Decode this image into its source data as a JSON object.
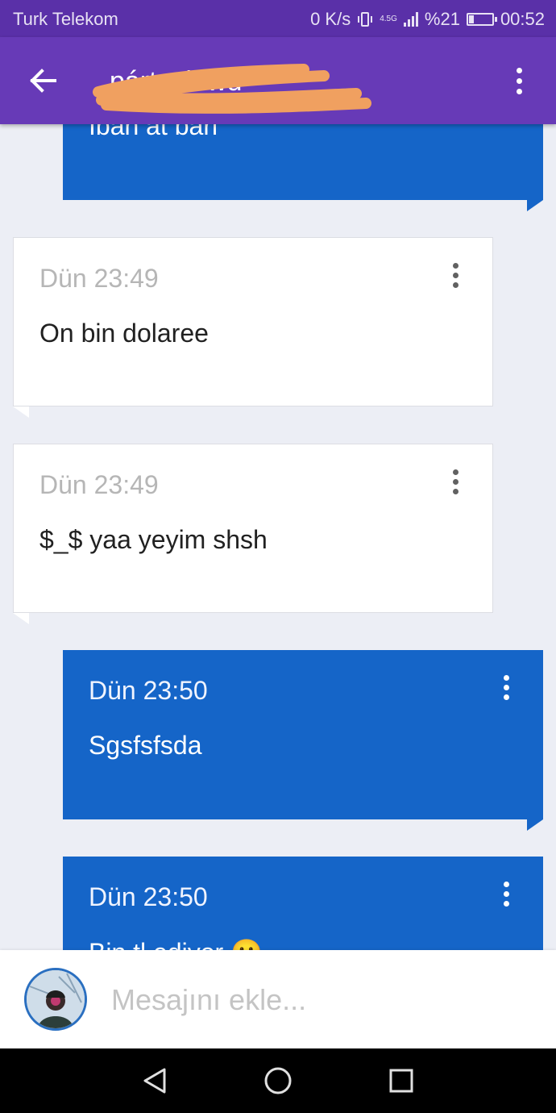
{
  "status_bar": {
    "carrier": "Turk Telekom",
    "speed": "0 K/s",
    "network": "4.5G",
    "battery": "%21",
    "battery_level": 0.21,
    "time": "00:52"
  },
  "app_bar": {
    "title": "pártoclowd",
    "back_icon": "arrow-left-icon",
    "menu_icon": "more-vert-icon"
  },
  "messages": [
    {
      "direction": "out",
      "time": "",
      "text": "Iban at bari"
    },
    {
      "direction": "in",
      "time": "Dün 23:49",
      "text": "On bin dolaree"
    },
    {
      "direction": "in",
      "time": "Dün 23:49",
      "text": "$_$ yaa yeyim shsh"
    },
    {
      "direction": "out",
      "time": "Dün 23:50",
      "text": "Sgsfsfsda"
    },
    {
      "direction": "out",
      "time": "Dün 23:50",
      "text": "Bin tl ediyor 🙂"
    }
  ],
  "composer": {
    "placeholder": "Mesajını ekle..."
  },
  "colors": {
    "status_bar": "#5a30a8",
    "app_bar": "#673ab7",
    "outgoing_bubble": "#1565c8",
    "incoming_bubble": "#ffffff",
    "background": "#eceef5"
  }
}
